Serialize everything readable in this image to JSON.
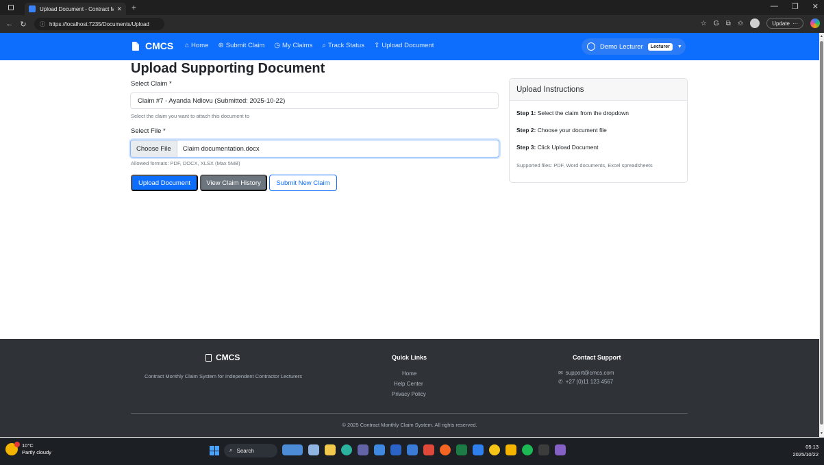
{
  "browser": {
    "tab_title": "Upload Document - Contract Mo...",
    "url": "https://localhost:7235/Documents/Upload",
    "update_label": "Update"
  },
  "navbar": {
    "brand": "CMCS",
    "links": [
      {
        "label": "Home",
        "icon": "house-icon"
      },
      {
        "label": "Submit Claim",
        "icon": "plus-circle-icon"
      },
      {
        "label": "My Claims",
        "icon": "clock-icon"
      },
      {
        "label": "Track Status",
        "icon": "search-icon"
      },
      {
        "label": "Upload Document",
        "icon": "upload-icon"
      }
    ],
    "user_name": "Demo Lecturer",
    "user_role": "Lecturer"
  },
  "main": {
    "title": "Upload Supporting Document",
    "claim_label": "Select Claim *",
    "claim_selected": "Claim #7 - Ayanda Ndlovu (Submitted: 2025-10-22)",
    "claim_help": "Select the claim you want to attach this document to",
    "file_label": "Select File *",
    "file_button": "Choose File",
    "file_name": "Claim documentation.docx",
    "file_help": "Allowed formats: PDF, DOCX, XLSX (Max 5MB)",
    "buttons": {
      "upload": "Upload Document",
      "history": "View Claim History",
      "new_claim": "Submit New Claim"
    }
  },
  "instructions": {
    "title": "Upload Instructions",
    "steps": [
      {
        "label": "Step 1:",
        "text": " Select the claim from the dropdown"
      },
      {
        "label": "Step 2:",
        "text": " Choose your document file"
      },
      {
        "label": "Step 3:",
        "text": " Click Upload Document"
      }
    ],
    "note": "Supported files: PDF, Word documents, Excel spreadsheets"
  },
  "footer": {
    "brand": "CMCS",
    "description": "Contract Monthly Claim System for Independent Contractor Lecturers",
    "quick_links_title": "Quick Links",
    "quick_links": [
      "Home",
      "Help Center",
      "Privacy Policy"
    ],
    "contact_title": "Contact Support",
    "email": "support@cmcs.com",
    "phone": "+27 (0)11 123 4567",
    "copyright": "© 2025 Contract Monthly Claim System. All rights reserved."
  },
  "taskbar": {
    "temperature": "10°C",
    "weather": "Partly cloudy",
    "search_label": "Search",
    "time": "05:13",
    "date": "2025/10/22"
  },
  "colors": {
    "primary": "#0d6efd",
    "secondary": "#6c757d",
    "footer_bg": "#2f3338"
  }
}
